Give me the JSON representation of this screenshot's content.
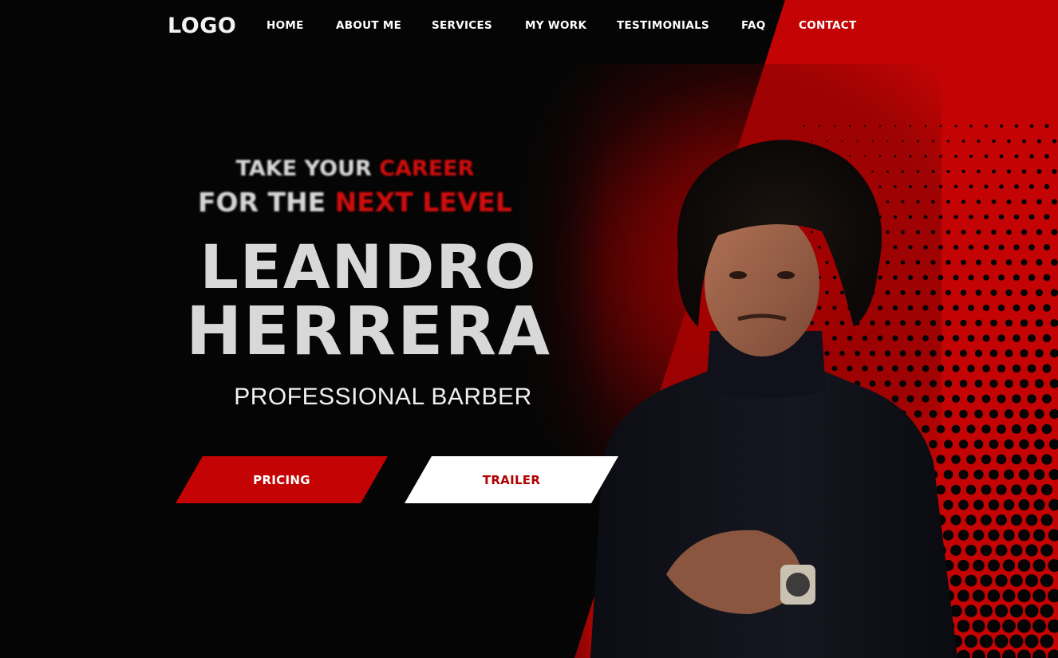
{
  "colors": {
    "accent": "#c40404",
    "background": "#050505",
    "text": "#d8d8d8"
  },
  "nav": {
    "logo": "LOGO",
    "items": [
      "HOME",
      "ABOUT ME",
      "SERVICES",
      "MY WORK",
      "TESTIMONIALS",
      "FAQ",
      "CONTACT"
    ]
  },
  "hero": {
    "tagline_line1_a": "TAKE YOUR ",
    "tagline_line1_b": "CAREER",
    "tagline_line2_a": "FOR THE ",
    "tagline_line2_b": "NEXT LEVEL",
    "name_line1": "LEANDRO",
    "name_line2": "HERRERA",
    "profession": "PROFESSIONAL BARBER"
  },
  "buttons": {
    "pricing": "PRICING",
    "trailer": "TRAILER"
  },
  "images": {
    "hero_photo": "portrait-man-black-turtleneck"
  }
}
